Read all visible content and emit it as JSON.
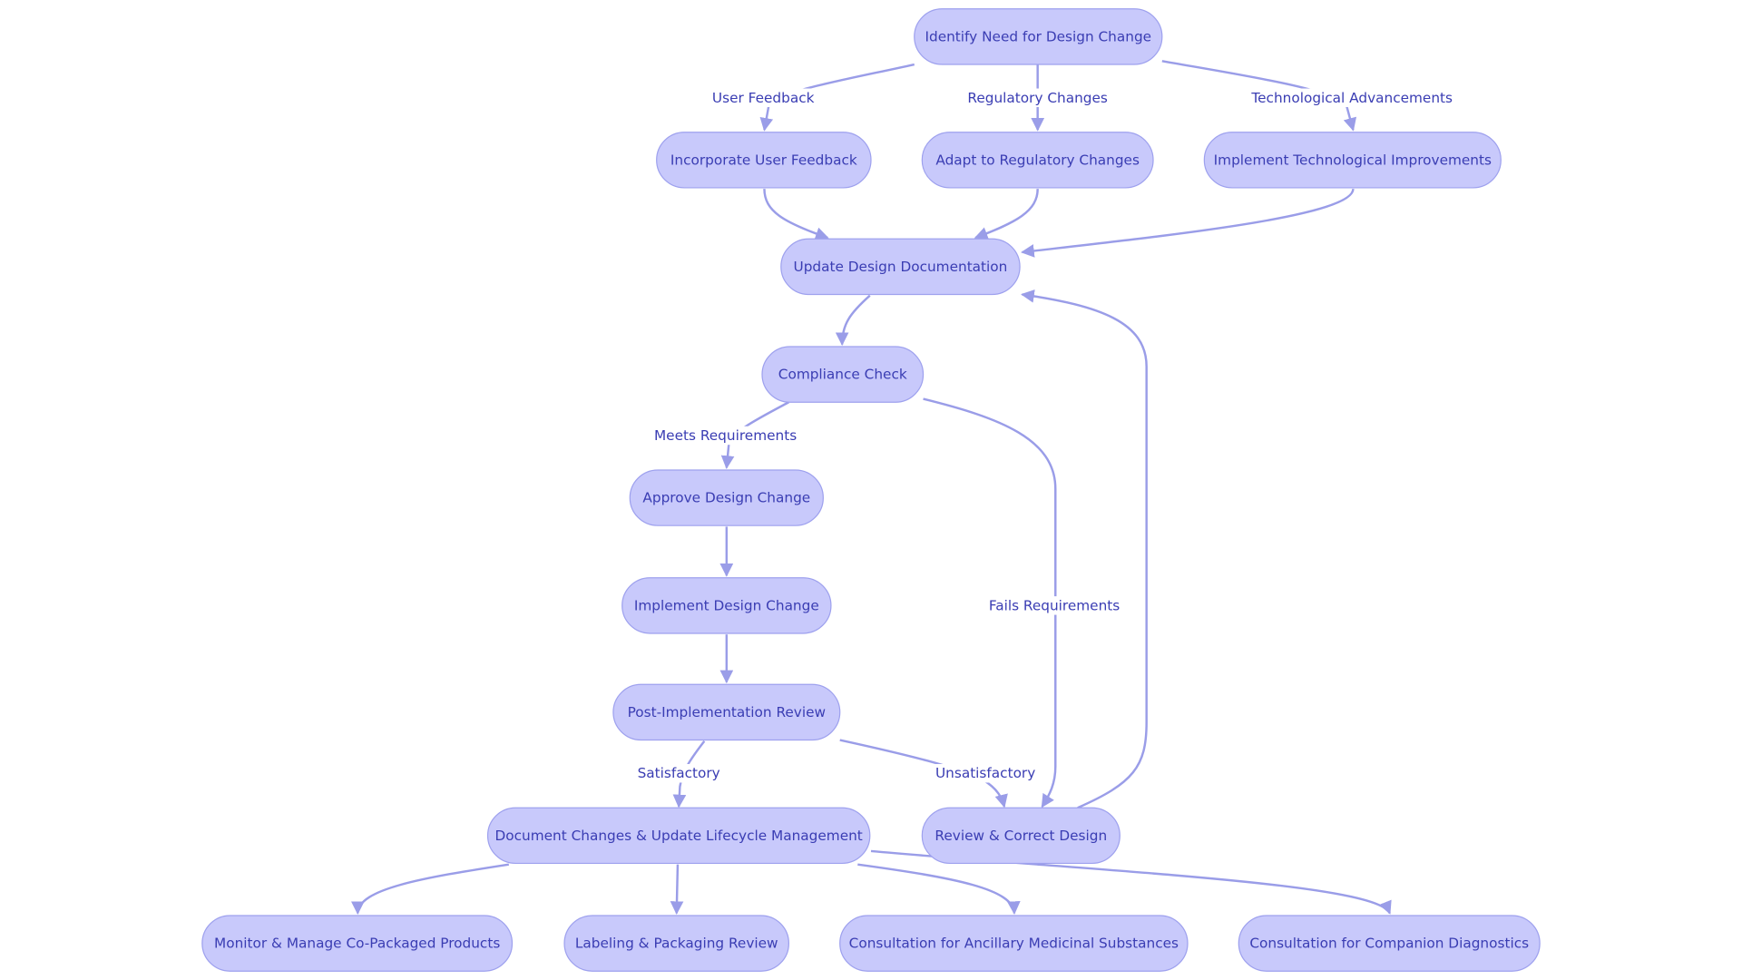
{
  "diagram": {
    "type": "flowchart",
    "colors": {
      "node_fill": "#c8c9fb",
      "node_stroke": "#9ea1ee",
      "text": "#3a3db3",
      "edge": "#9a9de8"
    },
    "nodes": [
      {
        "id": "identify",
        "label": "Identify Need for Design Change"
      },
      {
        "id": "user",
        "label": "Incorporate User Feedback"
      },
      {
        "id": "reg",
        "label": "Adapt to Regulatory Changes"
      },
      {
        "id": "tech",
        "label": "Implement Technological Improvements"
      },
      {
        "id": "update",
        "label": "Update Design Documentation"
      },
      {
        "id": "compliance",
        "label": "Compliance Check"
      },
      {
        "id": "approve",
        "label": "Approve Design Change"
      },
      {
        "id": "implement",
        "label": "Implement Design Change"
      },
      {
        "id": "post",
        "label": "Post-Implementation Review"
      },
      {
        "id": "document",
        "label": "Document Changes & Update Lifecycle Management"
      },
      {
        "id": "review",
        "label": "Review & Correct Design"
      },
      {
        "id": "monitor",
        "label": "Monitor & Manage Co-Packaged Products"
      },
      {
        "id": "labeling",
        "label": "Labeling & Packaging Review"
      },
      {
        "id": "ancillary",
        "label": "Consultation for Ancillary Medicinal Substances"
      },
      {
        "id": "companion",
        "label": "Consultation for Companion Diagnostics"
      }
    ],
    "edges": [
      {
        "id": "e1",
        "from": "identify",
        "to": "user",
        "label": "User Feedback"
      },
      {
        "id": "e2",
        "from": "identify",
        "to": "reg",
        "label": "Regulatory Changes"
      },
      {
        "id": "e3",
        "from": "identify",
        "to": "tech",
        "label": "Technological Advancements"
      },
      {
        "id": "e4",
        "from": "user",
        "to": "update",
        "label": ""
      },
      {
        "id": "e5",
        "from": "reg",
        "to": "update",
        "label": ""
      },
      {
        "id": "e6",
        "from": "tech",
        "to": "update",
        "label": ""
      },
      {
        "id": "e7",
        "from": "update",
        "to": "compliance",
        "label": ""
      },
      {
        "id": "e8",
        "from": "compliance",
        "to": "approve",
        "label": "Meets Requirements"
      },
      {
        "id": "e9",
        "from": "compliance",
        "to": "review",
        "label": "Fails Requirements"
      },
      {
        "id": "e10",
        "from": "approve",
        "to": "implement",
        "label": ""
      },
      {
        "id": "e11",
        "from": "implement",
        "to": "post",
        "label": ""
      },
      {
        "id": "e12",
        "from": "post",
        "to": "document",
        "label": "Satisfactory"
      },
      {
        "id": "e13",
        "from": "post",
        "to": "review",
        "label": "Unsatisfactory"
      },
      {
        "id": "e14",
        "from": "review",
        "to": "update",
        "label": ""
      },
      {
        "id": "e15",
        "from": "document",
        "to": "monitor",
        "label": ""
      },
      {
        "id": "e16",
        "from": "document",
        "to": "labeling",
        "label": ""
      },
      {
        "id": "e17",
        "from": "document",
        "to": "ancillary",
        "label": ""
      },
      {
        "id": "e18",
        "from": "document",
        "to": "companion",
        "label": ""
      }
    ]
  }
}
